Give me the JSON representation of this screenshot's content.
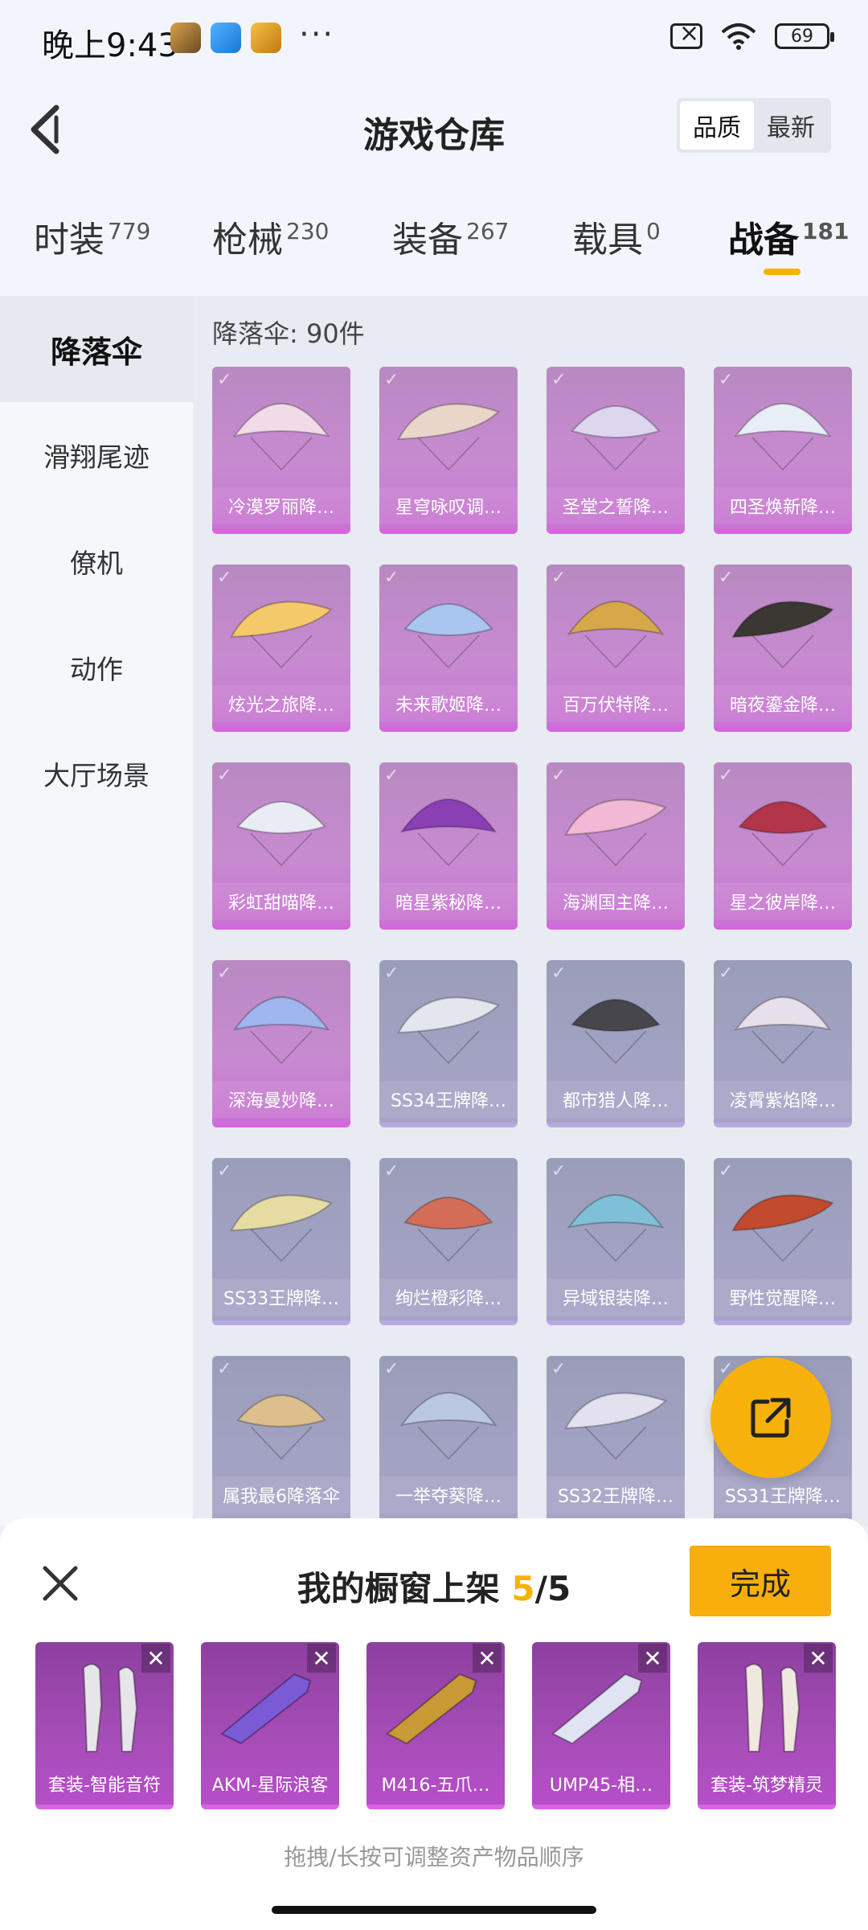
{
  "status_bar": {
    "time": "晚上9:43",
    "more": "···",
    "battery": "69"
  },
  "header": {
    "title": "游戏仓库",
    "sort_options": [
      "品质",
      "最新"
    ],
    "active_sort": "品质"
  },
  "tabs": [
    {
      "label": "时装",
      "count": "779"
    },
    {
      "label": "枪械",
      "count": "230"
    },
    {
      "label": "装备",
      "count": "267"
    },
    {
      "label": "载具",
      "count": "0"
    },
    {
      "label": "战备",
      "count": "181",
      "active": true
    }
  ],
  "sidebar": {
    "items": [
      "降落伞",
      "滑翔尾迹",
      "僚机",
      "动作",
      "大厅场景"
    ],
    "active": "降落伞"
  },
  "content": {
    "count_label": "降落伞: 90件",
    "items": [
      {
        "name": "冷漠罗丽降…",
        "tone": "purple",
        "color": "#f1dbe6"
      },
      {
        "name": "星穹咏叹调…",
        "tone": "purple",
        "color": "#ead6c8"
      },
      {
        "name": "圣堂之誓降…",
        "tone": "purple",
        "color": "#dcd6ee"
      },
      {
        "name": "四圣焕新降…",
        "tone": "purple",
        "color": "#e7eef6"
      },
      {
        "name": "炫光之旅降…",
        "tone": "purple",
        "color": "#f4c96a"
      },
      {
        "name": "未来歌姬降…",
        "tone": "purple",
        "color": "#a8c6ef"
      },
      {
        "name": "百万伏特降…",
        "tone": "purple",
        "color": "#d7a84a"
      },
      {
        "name": "暗夜鎏金降…",
        "tone": "purple",
        "color": "#3b3833"
      },
      {
        "name": "彩虹甜喵降…",
        "tone": "purple",
        "color": "#e9ecf3"
      },
      {
        "name": "暗星紫秘降…",
        "tone": "purple",
        "color": "#8a3fb5"
      },
      {
        "name": "海渊国主降…",
        "tone": "purple",
        "color": "#f2b8d4"
      },
      {
        "name": "星之彼岸降…",
        "tone": "purple",
        "color": "#b2354a"
      },
      {
        "name": "深海曼妙降…",
        "tone": "purple",
        "color": "#9fb6ef"
      },
      {
        "name": "SS34王牌降…",
        "tone": "grey",
        "color": "#e4e6ee"
      },
      {
        "name": "都市猎人降…",
        "tone": "grey",
        "color": "#46464c"
      },
      {
        "name": "凌霄紫焰降…",
        "tone": "grey",
        "color": "#e7dfe9"
      },
      {
        "name": "SS33王牌降…",
        "tone": "grey",
        "color": "#e6dca3"
      },
      {
        "name": "绚烂橙彩降…",
        "tone": "grey",
        "color": "#d46d57"
      },
      {
        "name": "异域银装降…",
        "tone": "grey",
        "color": "#7fc0d6"
      },
      {
        "name": "野性觉醒降…",
        "tone": "grey",
        "color": "#c24a2e"
      },
      {
        "name": "属我最6降落伞",
        "tone": "grey",
        "color": "#dcbf8c"
      },
      {
        "name": "一举夺葵降…",
        "tone": "grey",
        "color": "#b9c7e1"
      },
      {
        "name": "SS32王牌降…",
        "tone": "grey",
        "color": "#e3e0ef"
      },
      {
        "name": "SS31王牌降…",
        "tone": "grey",
        "color": "#d9d9e2"
      }
    ]
  },
  "panel": {
    "title_prefix": "我的橱窗上架 ",
    "current": "5",
    "separator": "/",
    "max": "5",
    "done_label": "完成",
    "remove_symbol": "✕",
    "items": [
      {
        "name": "套装-智能音符",
        "color": "#e6e6ea"
      },
      {
        "name": "AKM-星际浪客",
        "color": "#7b5ad6"
      },
      {
        "name": "M416-五爪…",
        "color": "#c89a35"
      },
      {
        "name": "UMP45-相…",
        "color": "#dfe3f2"
      },
      {
        "name": "套装-筑梦精灵",
        "color": "#efe8df"
      }
    ],
    "hint": "拖拽/长按可调整资产物品顺序"
  },
  "icons": {
    "back": "chevron-left-icon",
    "share": "share-external-icon",
    "close": "close-icon",
    "check": "check-icon"
  },
  "colors": {
    "accent": "#f4b400",
    "done_button": "#f8ae0b",
    "card_purple": "#c78ad0",
    "card_grey": "#a2a2c2"
  }
}
